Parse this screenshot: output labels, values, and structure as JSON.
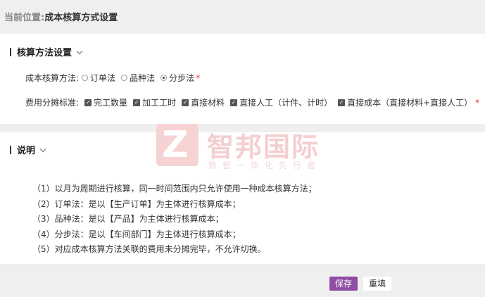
{
  "breadcrumb": {
    "label": "当前位置:",
    "current": "成本核算方式设置"
  },
  "section1": {
    "title": "核算方法设置",
    "method": {
      "label": "成本核算方法:",
      "options": [
        "订单法",
        "品种法",
        "分步法"
      ],
      "selected": "分步法",
      "required": "*"
    },
    "allocation": {
      "label": "费用分摊标准:",
      "options": [
        "完工数量",
        "加工工时",
        "直接材料",
        "直接人工（计件、计时）",
        "直接成本（直接材料+直接人工）"
      ],
      "checked": [
        true,
        true,
        true,
        true,
        true
      ],
      "required": "*"
    }
  },
  "section2": {
    "title": "说明",
    "notes": [
      "（1）以月为周期进行核算，同一时间范围内只允许使用一种成本核算方法；",
      "（2）订单法：是以【生产订单】为主体进行核算成本；",
      "（3）品种法：是以【产品】为主体进行核算成本；",
      "（4）分步法：是以【车间部门】为主体进行核算成本；",
      "（5）对应成本核算方法关联的费用未分摊完毕，不允许切换。"
    ]
  },
  "watermark": {
    "logo_letter": "Z",
    "name": "智邦国际",
    "slogan": "数智一体化先行者"
  },
  "buttons": {
    "save": "保存",
    "reset": "重填"
  },
  "colors": {
    "primary": "#8e4ea4",
    "required": "#e33333",
    "watermark": "#f4cfcf"
  }
}
